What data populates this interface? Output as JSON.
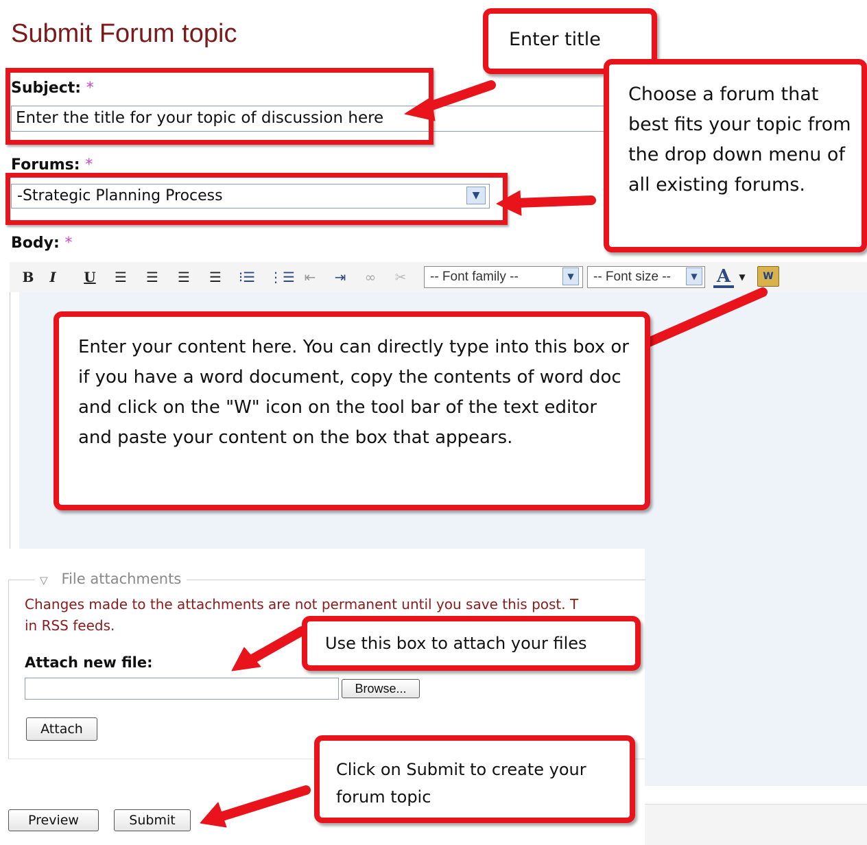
{
  "page": {
    "title": "Submit Forum topic"
  },
  "form": {
    "subject_label": "Subject:",
    "required_mark": "*",
    "subject_value": "Enter the title for your topic of discussion here",
    "forums_label": "Forums:",
    "forums_selected": "-Strategic Planning Process",
    "body_label": "Body:"
  },
  "toolbar": {
    "bold": "B",
    "italic": "I",
    "underline": "U",
    "font_family": "-- Font family --",
    "font_size": "-- Font size --",
    "text_color": "A"
  },
  "attachments": {
    "legend": "File attachments",
    "warning_line1": "Changes made to the attachments are not permanent until you save this post. T",
    "warning_line2": "in RSS feeds.",
    "attach_label": "Attach new file:",
    "browse_label": "Browse...",
    "attach_button": "Attach"
  },
  "actions": {
    "preview": "Preview",
    "submit": "Submit"
  },
  "callouts": {
    "title": "Enter title",
    "forum": "Choose a forum that best fits your topic from the drop down menu of all existing forums.",
    "body": "Enter your content here. You can directly type into this box or if you have a word document, copy the contents of word doc and click on the \"W\" icon on the tool bar of the text editor and paste your content on the box that appears.",
    "attach": "Use this box to attach your files",
    "submit": "Click on Submit to create your forum topic"
  },
  "colors": {
    "annotation_red": "#e8131b",
    "title_red": "#7a1a1a",
    "required_pink": "#d046c6",
    "editor_bg": "#eef3fa"
  }
}
